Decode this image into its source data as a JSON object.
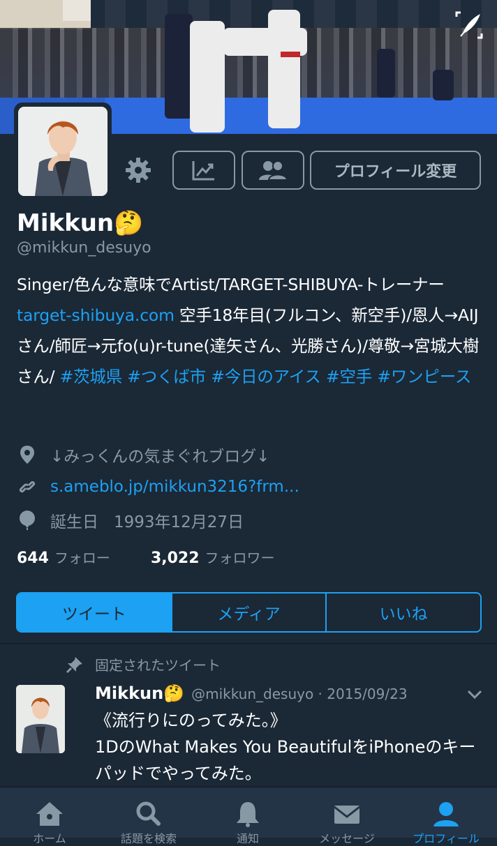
{
  "header": {
    "edit_banner_icon": "edit-image-icon"
  },
  "profile": {
    "name": "Mikkun🤔",
    "handle": "@mikkun_desuyo",
    "bio_parts": {
      "p1": "Singer/色んな意味でArtist/TARGET-SHIBUYA-トレーナー",
      "link": "target-shibuya.com",
      "p2": " 空手18年目(フルコン、新空手)/恩人→AIJさん/師匠→元fo(u)r-tune(達矢さん、光勝さん)/尊敬→宮城大樹さん/ ",
      "tag1": "#茨城県",
      "tag2": "#つくば市",
      "tag3": "#今日のアイス",
      "tag4": "#空手",
      "tag5": "#ワンピース"
    },
    "location": "↓みっくんの気まぐれブログ↓",
    "website": "s.ameblo.jp/mikkun3216?frm...",
    "birthday_label": "誕生日",
    "birthday_value": "1993年12月27日",
    "following_count": "644",
    "following_label": "フォロー",
    "followers_count": "3,022",
    "followers_label": "フォロワー"
  },
  "actions": {
    "settings_icon": "gear-icon",
    "analytics_icon": "analytics-icon",
    "people_icon": "people-icon",
    "edit_profile_label": "プロフィール変更"
  },
  "tabs": [
    {
      "label": "ツイート",
      "active": true
    },
    {
      "label": "メディア",
      "active": false
    },
    {
      "label": "いいね",
      "active": false
    }
  ],
  "pinned_tweet": {
    "pinned_label": "固定されたツイート",
    "name": "Mikkun🤔",
    "handle_date": "@mikkun_desuyo · 2015/09/23",
    "text": "《流行りにのってみた。》\n1DのWhat Makes You BeautifulをiPhoneのキーパッドでやってみた。"
  },
  "bottom_nav": [
    {
      "label": "ホーム",
      "icon": "home-icon",
      "active": false
    },
    {
      "label": "話題を検索",
      "icon": "search-icon",
      "active": false
    },
    {
      "label": "通知",
      "icon": "bell-icon",
      "active": false
    },
    {
      "label": "メッセージ",
      "icon": "mail-icon",
      "active": false
    },
    {
      "label": "プロフィール",
      "icon": "person-icon",
      "active": true
    }
  ],
  "colors": {
    "background": "#1b2836",
    "accent": "#1da1f2",
    "muted": "#8899a6"
  }
}
